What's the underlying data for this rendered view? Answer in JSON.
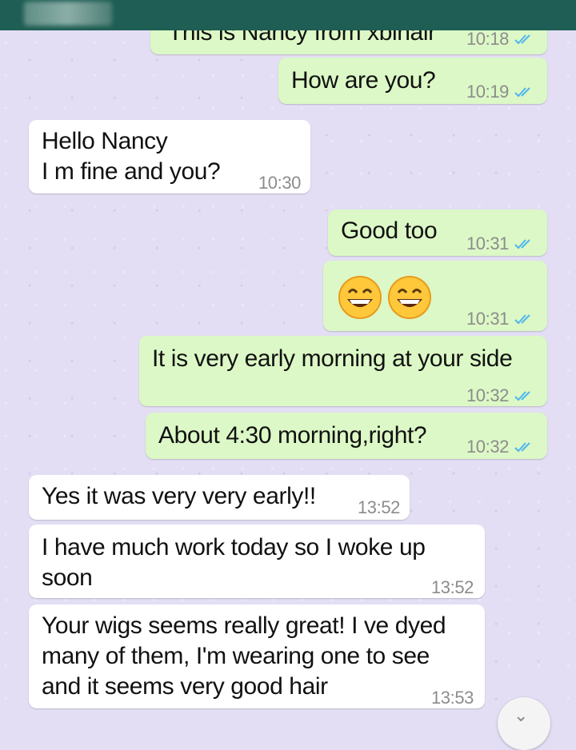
{
  "colors": {
    "header": "#1f5e54",
    "background": "#e3def4",
    "outgoing_bubble": "#dcf8c6",
    "incoming_bubble": "#ffffff",
    "read_ticks": "#4fb6ec"
  },
  "messages": [
    {
      "direction": "out",
      "text": "This is Nancy from xbihair",
      "time": "10:18",
      "status_icon": "double-check-read-icon"
    },
    {
      "direction": "out",
      "text": "How are you?",
      "time": "10:19",
      "status_icon": "double-check-read-icon"
    },
    {
      "direction": "in",
      "text": "Hello Nancy\nI m fine and you?",
      "time": "10:30"
    },
    {
      "direction": "out",
      "text": "Good too",
      "time": "10:31",
      "status_icon": "double-check-read-icon"
    },
    {
      "direction": "out",
      "text": "😄😄",
      "time": "10:31",
      "status_icon": "double-check-read-icon"
    },
    {
      "direction": "out",
      "text": "It is very early morning at your side",
      "time": "10:32",
      "status_icon": "double-check-read-icon"
    },
    {
      "direction": "out",
      "text": "About 4:30 morning,right?",
      "time": "10:32",
      "status_icon": "double-check-read-icon"
    },
    {
      "direction": "in",
      "text": "Yes it was very very early!!",
      "time": "13:52"
    },
    {
      "direction": "in",
      "text": "I have much work today so I woke up\nsoon",
      "time": "13:52"
    },
    {
      "direction": "in",
      "text": "Your wigs seems really great! I ve dyed\nmany of them, I'm wearing one to see\nand it seems very good hair",
      "time": "13:53"
    }
  ],
  "scroll_button": {
    "icon": "chevron-down-icon"
  }
}
